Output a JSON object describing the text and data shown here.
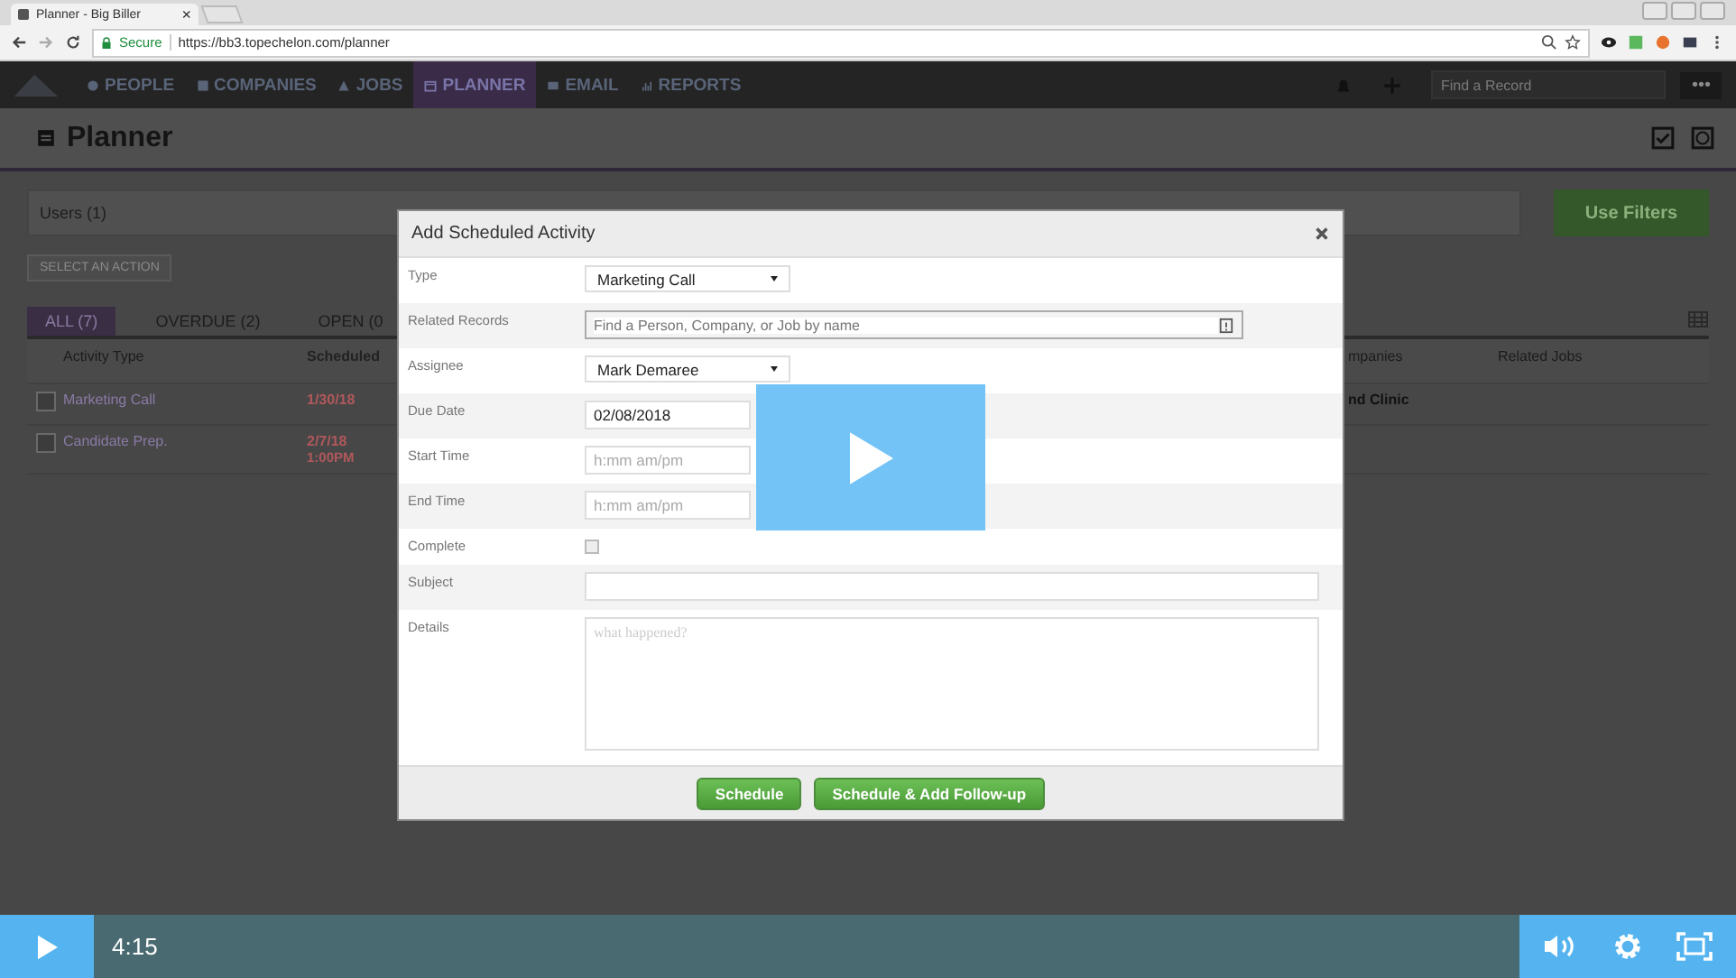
{
  "browser": {
    "tab_title": "Planner - Big Biller",
    "tab_close": "×",
    "secure_label": "Secure",
    "url": "https://bb3.topechelon.com/planner"
  },
  "app_nav": {
    "items": [
      {
        "label": "PEOPLE",
        "selected": false
      },
      {
        "label": "COMPANIES",
        "selected": false
      },
      {
        "label": "JOBS",
        "selected": false
      },
      {
        "label": "PLANNER",
        "selected": true
      },
      {
        "label": "EMAIL",
        "selected": false
      },
      {
        "label": "REPORTS",
        "selected": false
      }
    ],
    "search_placeholder": "Find a Record",
    "more": "•••"
  },
  "page": {
    "title": "Planner",
    "users_filter": "Users (1)",
    "use_filters_button": "Use Filters",
    "action_button": "SELECT AN ACTION",
    "tabs": [
      {
        "label": "ALL (7)",
        "selected": true
      },
      {
        "label": "OVERDUE (2)",
        "selected": false
      },
      {
        "label": "OPEN (0",
        "selected": false
      }
    ],
    "table": {
      "columns": [
        "Activity Type",
        "Scheduled",
        "mpanies",
        "Related Jobs"
      ],
      "rows": [
        {
          "checked": false,
          "activity_type": "Marketing Call",
          "scheduled": "1/30/18",
          "companies": "nd Clinic"
        },
        {
          "checked": false,
          "activity_type": "Candidate Prep.",
          "scheduled": "2/7/18",
          "scheduled_time": "1:00PM"
        }
      ]
    }
  },
  "modal": {
    "title": "Add Scheduled Activity",
    "fields": [
      {
        "kind": "select",
        "label": "Type",
        "value": "Marketing Call"
      },
      {
        "kind": "search",
        "label": "Related Records",
        "placeholder": "Find a Person, Company, or Job by name"
      },
      {
        "kind": "select",
        "label": "Assignee",
        "value": "Mark Demaree"
      },
      {
        "kind": "date",
        "label": "Due Date",
        "value": "02/08/2018"
      },
      {
        "kind": "time",
        "label": "Start Time",
        "placeholder": "h:mm am/pm"
      },
      {
        "kind": "time",
        "label": "End Time",
        "placeholder": "h:mm am/pm"
      },
      {
        "kind": "checkbox",
        "label": "Complete",
        "checked": false
      },
      {
        "kind": "text",
        "label": "Subject"
      },
      {
        "kind": "textarea",
        "label": "Details",
        "placeholder": "what happened?"
      }
    ],
    "buttons": [
      "Schedule",
      "Schedule & Add Follow-up"
    ]
  },
  "video_player": {
    "time": "4:15"
  }
}
